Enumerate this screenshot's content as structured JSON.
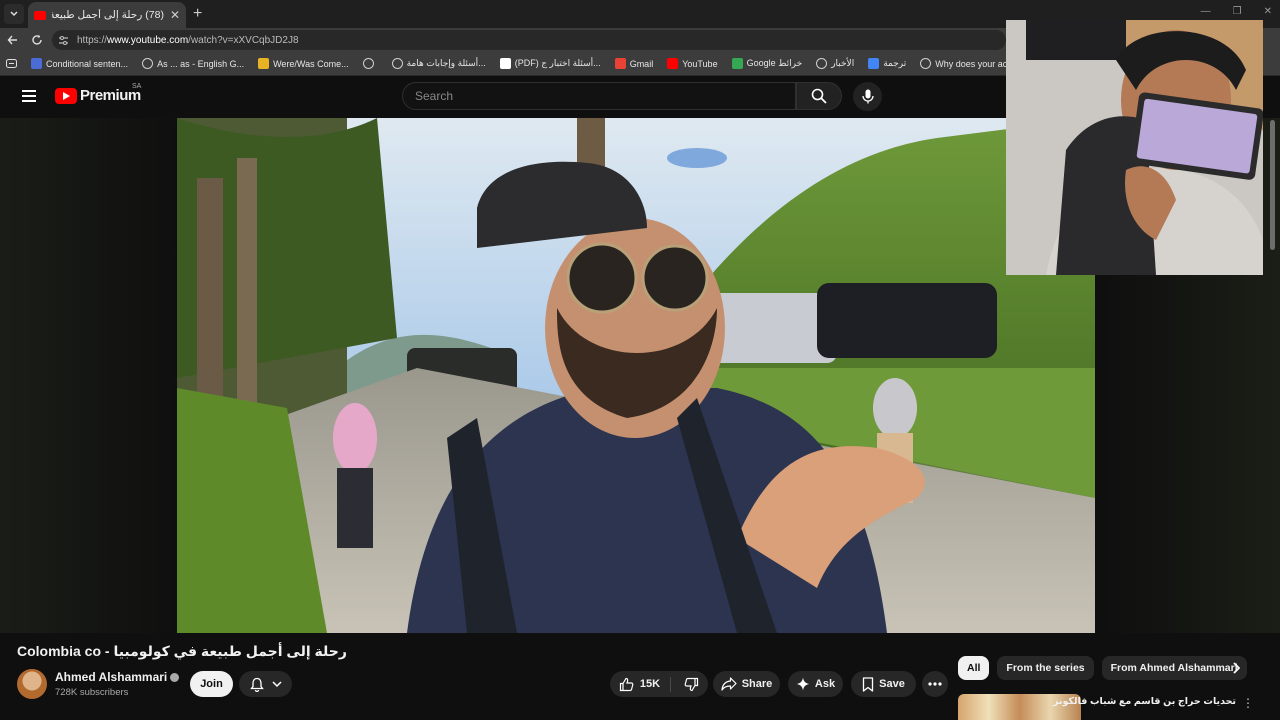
{
  "browser": {
    "tab_title": "(78) رحلة إلى أجمل طبيعة في كولومبيا",
    "url_scheme": "https://",
    "url_host": "www.youtube.com",
    "url_path": "/watch?v=xXVCqbJD2J8",
    "bookmarks": [
      {
        "label": "Conditional senten...",
        "icon_color": "#4a6cd4"
      },
      {
        "label": "As ... as - English G...",
        "icon_color": "#9aa0a6"
      },
      {
        "label": "Were/Was Come...",
        "icon_color": "#e8b325"
      },
      {
        "label": "",
        "icon_color": "#9aa0a6"
      },
      {
        "label": "أسئلة وإجابات هامة...",
        "icon_color": "#9aa0a6"
      },
      {
        "label": "(PDF) أسئلة اختبار ج...",
        "icon_color": "#ffffff"
      },
      {
        "label": "Gmail",
        "icon_color": "#ea4335"
      },
      {
        "label": "YouTube",
        "icon_color": "#ff0000"
      },
      {
        "label": "Google خرائط",
        "icon_color": "#34a853"
      },
      {
        "label": "الأخبار",
        "icon_color": "#9aa0a6"
      },
      {
        "label": "ترجمة",
        "icon_color": "#4285f4"
      },
      {
        "label": "Why does your acc...",
        "icon_color": "#9aa0a6"
      },
      {
        "label": ".",
        "icon_color": "#9aa0a6"
      },
      {
        "label": "",
        "icon_color": "#9aa0a6"
      }
    ]
  },
  "youtube": {
    "logo_text": "Premium",
    "region": "SA",
    "search_placeholder": "Search",
    "video_title": "رحلة إلى أجمل طبيعة في كولومبيا - Colombia co",
    "channel_name": "Ahmed Alshammari",
    "subscribers": "728K subscribers",
    "join_label": "Join",
    "like_count": "15K",
    "share_label": "Share",
    "ask_label": "Ask",
    "save_label": "Save",
    "chips": [
      "All",
      "From the series",
      "From Ahmed Alshammari"
    ],
    "recommendation_title": "تحديات حراج بن قاسم مع شباب فالكونز"
  },
  "colors": {
    "accent": "#ff0000",
    "background": "#0f0f0f",
    "button": "#272727"
  }
}
